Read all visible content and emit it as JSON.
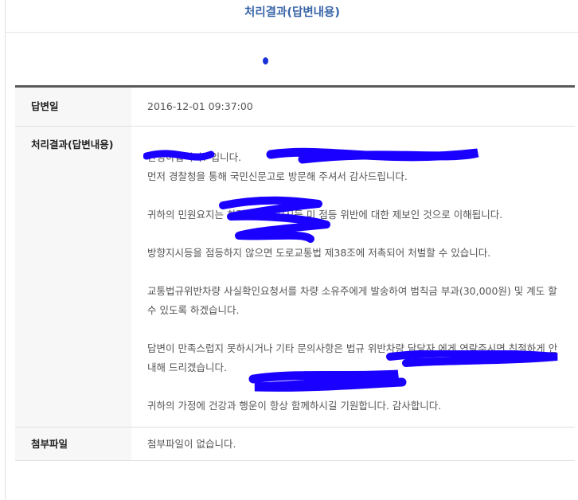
{
  "header": {
    "title": "처리결과(답변내용)"
  },
  "table": {
    "date_label": "답변일",
    "date_value": "2016-12-01 09:37:00",
    "answer_label": "처리결과(답변내용)",
    "answer_paragraphs": [
      "안녕하십니까?                                                                입니다.\n먼저 경찰청을 통해 국민신문고로 방문해 주셔서 감사드립니다.",
      "귀하의 민원요지는                  차량의 방향지시등 미 점등 위반에 대한 제보인 것으로 이해됩니다.",
      "방향지시등을 점등하지 않으면 도로교통법 제38조에 저촉되어 처벌할 수 있습니다.",
      "교통법규위반차량 사실확인요청서를 차량 소유주에게 발송하여 범칙금 부과(30,000원) 및 계도 할 수 있도록 하겠습니다.",
      "답변이 만족스럽지 못하시거나 기타 문의사항은                                      법규 위반차량 담당자                                       에게 연락주시면 친절하게 안내해 드리겠습니다.",
      "귀하의 가정에 건강과 행운이 항상 함께하시길 기원합니다. 감사합니다."
    ],
    "file_label": "첨부파일",
    "file_value": "첨부파일이 없습니다."
  },
  "colors": {
    "title": "#3a66a8",
    "redaction": "#1a00ff",
    "dot": "#1930d8"
  }
}
